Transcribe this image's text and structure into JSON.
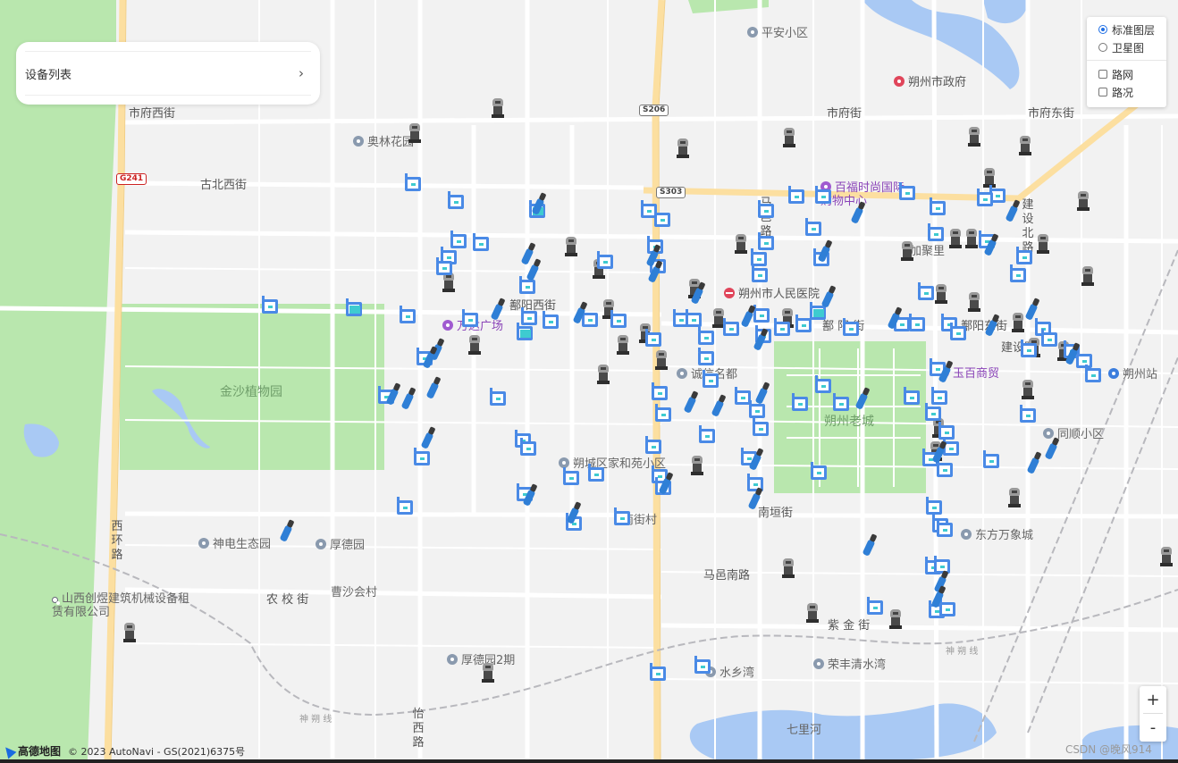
{
  "panel": {
    "device_list_label": "设备列表",
    "chevron": "›"
  },
  "layers": {
    "standard": "标准图层",
    "satellite": "卫星图",
    "road_net": "路网",
    "traffic": "路况"
  },
  "zoom": {
    "in": "+",
    "out": "-"
  },
  "attribution": {
    "brand": "高德地图",
    "copyright": "© 2023 AutoNavi - GS(2021)6375号"
  },
  "watermark": "CSDN @晚风914",
  "roads": {
    "fuxijie": "市府西街",
    "fujie": "市府街",
    "fudongjie": "市府东街",
    "gubeixijie": "古北西街",
    "eyangxijie": "鄯阳西街",
    "eyangjie": "鄯 阳 街",
    "eyangdongjie": "鄯阳东街",
    "jiansheroad": "建设路",
    "jianshebeilu": "建设北路",
    "mayilu": "马邑路",
    "mayinanlu": "马邑南路",
    "nanyuanjie": "南垣街",
    "xihuanlu": "西环路",
    "nongxiaojie": "农 校 街",
    "zijinjie": "紫 金 街",
    "yixilu": "怡西路",
    "shenshuoxian": "神 朔 线",
    "shenshuoxian2": "神 朔 线"
  },
  "shields": {
    "s206": "S206",
    "s303": "S303",
    "g241": "G241"
  },
  "pois": {
    "pingan": "平安小区",
    "zhengfu": "朔州市政府",
    "aolin": "奥林花园",
    "baifu": "百福时尚国际购物中心",
    "jiazhuju": "加聚里",
    "renmin": "朔州市人民医院",
    "wanda": "万达广场",
    "chengxin": "诚信名都",
    "yubai": "玉百商贸",
    "shuozhouzhan": "朔州站",
    "laocheng": "朔州老城",
    "tongshun": "同顺小区",
    "jiahe": "朔城区家和苑小区",
    "jinsha": "金沙植物园",
    "nanjiecun": "南街村",
    "dongfang": "东方万象城",
    "shendian": "神电生态园",
    "houde": "厚德园",
    "caoshahuicun": "曹沙会村",
    "chuangyu": "山西创煜建筑机械设备租赁有限公司",
    "houde2": "厚德园2期",
    "shuixiangwan": "水乡湾",
    "rongfeng": "荣丰清水湾",
    "qihe": "七里河"
  },
  "colors": {
    "device_blue": "#4a8ae6",
    "device_cyan": "#3ecbd0",
    "park_green": "#b9e7ae",
    "water": "#a9c9f4",
    "road_yellow": "#fcdfa0"
  }
}
